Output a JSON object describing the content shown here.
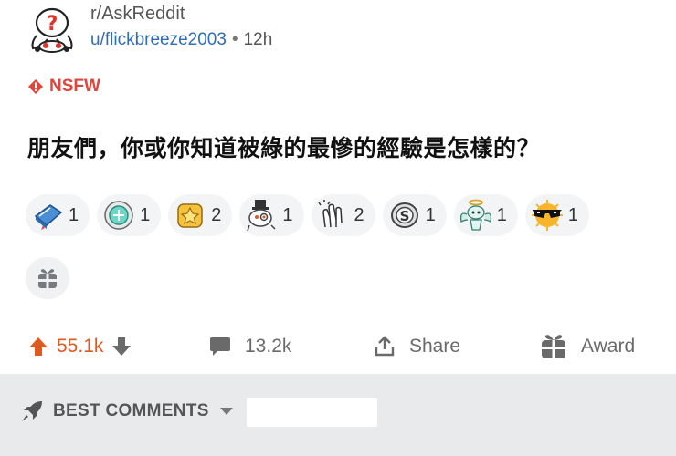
{
  "post": {
    "subreddit": "r/AskReddit",
    "author": "u/flickbreeze2003",
    "separator": "•",
    "age": "12h",
    "nsfw_label": "NSFW",
    "title": "朋友們，你或你知道被綠的最慘的經驗是怎樣的？"
  },
  "awards": [
    {
      "icon": "book-award-icon",
      "count": "1"
    },
    {
      "icon": "wholesome-seal-icon",
      "count": "1"
    },
    {
      "icon": "gold-star-icon",
      "count": "2"
    },
    {
      "icon": "snoo-monocle-icon",
      "count": "1"
    },
    {
      "icon": "clapping-hands-icon",
      "count": "2"
    },
    {
      "icon": "silver-coin-icon",
      "count": "1"
    },
    {
      "icon": "angel-snoo-icon",
      "count": "1"
    },
    {
      "icon": "sunglasses-sun-icon",
      "count": "1"
    }
  ],
  "actions": {
    "upvotes": "55.1k",
    "comments": "13.2k",
    "share": "Share",
    "award": "Award"
  },
  "comments_sort": {
    "label": "BEST COMMENTS"
  },
  "colors": {
    "upvote": "#e05a1f",
    "nsfw": "#e0453c",
    "link": "#2f6db6",
    "footer_bg": "#e9eaec"
  }
}
